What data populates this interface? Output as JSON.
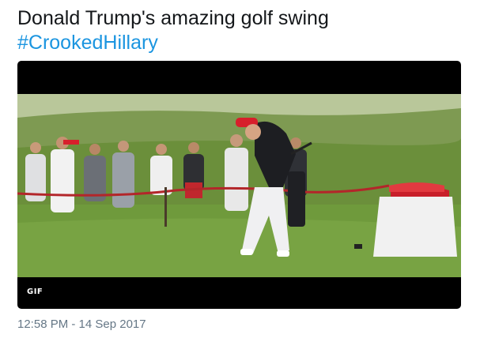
{
  "tweet": {
    "text": "Donald Trump's amazing golf swing",
    "hashtag": "#CrookedHillary",
    "media": {
      "type": "gif",
      "badge": "GIF",
      "colors": {
        "sky_band": "#b9c79a",
        "hillside": "#7e9a52",
        "fairway": "#6f9a3c",
        "rope": "#b3262a",
        "cap": "#d71f2b",
        "table_cloth": "#f1f1f1",
        "tee_box_cloth": "#c81f2a"
      }
    },
    "timestamp": "12:58 PM - 14 Sep 2017"
  }
}
